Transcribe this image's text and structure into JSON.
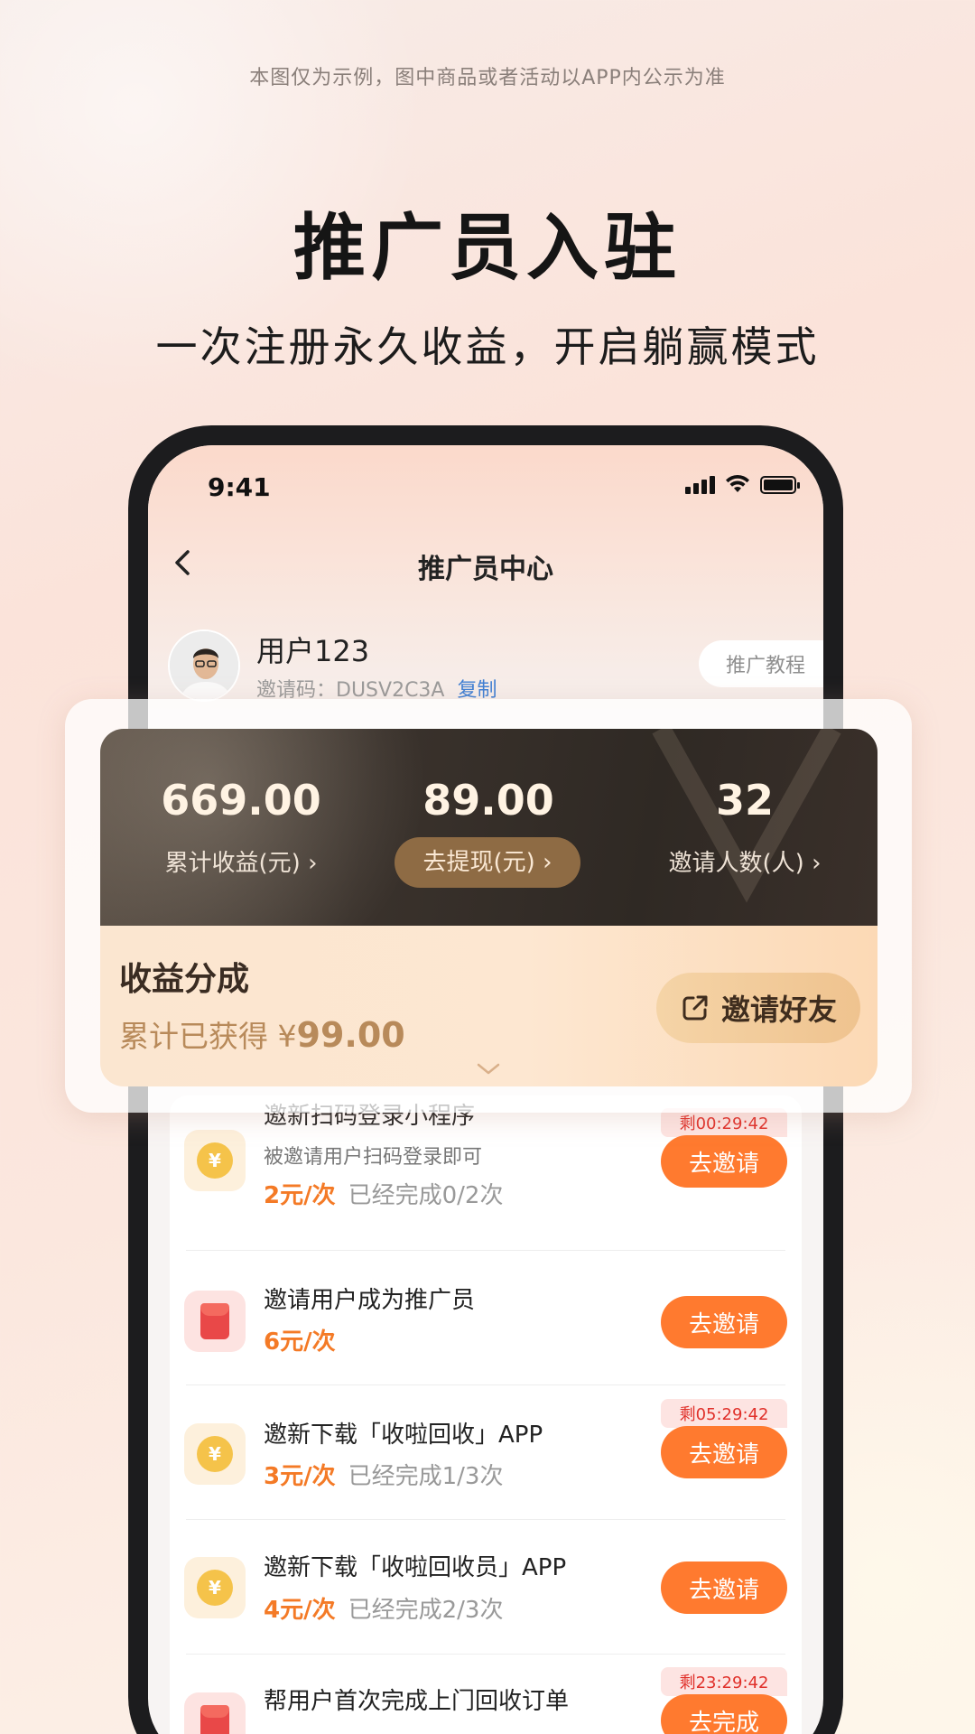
{
  "disclaimer": "本图仅为示例，图中商品或者活动以APP内公示为准",
  "hero": {
    "title": "推广员入驻",
    "subtitle": "一次注册永久收益，开启躺赢模式"
  },
  "status_bar": {
    "time": "9:41"
  },
  "nav": {
    "title": "推广员中心"
  },
  "user": {
    "name": "用户123",
    "invite_label": "邀请码：",
    "invite_code": "DUSV2C3A",
    "copy_label": "复制",
    "tutorial_label": "推广教程"
  },
  "stats": [
    {
      "value": "669.00",
      "label": "累计收益(元) ›"
    },
    {
      "value": "89.00",
      "label": "去提现(元) ›"
    },
    {
      "value": "32",
      "label": "邀请人数(人) ›"
    }
  ],
  "earnings": {
    "title": "收益分成",
    "sub_prefix": "累计已获得 ¥",
    "amount": "99.00",
    "invite_friend_label": "邀请好友"
  },
  "tasks": [
    {
      "title": "邀新扫码登录小程序",
      "desc": "被邀请用户扫码登录即可",
      "price": "2元/次",
      "progress": "已经完成0/2次",
      "timer": "剩00:29:42",
      "button": "去邀请",
      "icon": "coin-icon"
    },
    {
      "title": "邀请用户成为推广员",
      "price": "6元/次",
      "button": "去邀请",
      "icon": "red-envelope-icon"
    },
    {
      "title": "邀新下载「收啦回收」APP",
      "price": "3元/次",
      "progress": "已经完成1/3次",
      "timer": "剩05:29:42",
      "button": "去邀请",
      "icon": "coin-icon"
    },
    {
      "title": "邀新下载「收啦回收员」APP",
      "price": "4元/次",
      "progress": "已经完成2/3次",
      "button": "去邀请",
      "icon": "coin-icon"
    },
    {
      "title": "帮用户首次完成上门回收订单",
      "timer": "剩23:29:42",
      "button": "去完成",
      "icon": "red-envelope-icon"
    }
  ],
  "colors": {
    "accent_orange": "#ff7a2f",
    "reward_orange": "#f47a26",
    "timer_red": "#e0302a",
    "link_blue": "#3f7fd4"
  }
}
